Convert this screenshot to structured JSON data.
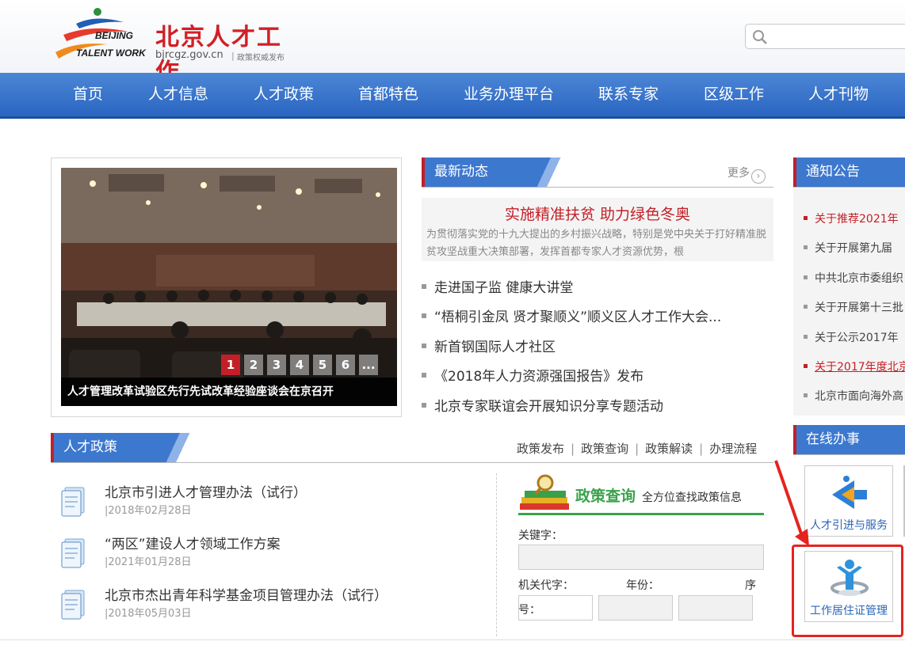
{
  "header": {
    "logo_en_line1": "BEIJING",
    "logo_en_line2": "TALENT WORK",
    "logo_cn": "北京人才工作",
    "logo_url": "bjrcgz.gov.cn",
    "logo_slogan": "政策权威发布",
    "search_value": ""
  },
  "nav": {
    "items": [
      "首页",
      "人才信息",
      "人才政策",
      "首都特色",
      "业务办理平台",
      "联系专家",
      "区级工作",
      "人才刊物"
    ]
  },
  "slider": {
    "caption": "人才管理改革试验区先行先试改革经验座谈会在京召开",
    "pages": [
      "1",
      "2",
      "3",
      "4",
      "5",
      "6",
      "..."
    ],
    "active_page": "1"
  },
  "latest_news": {
    "title": "最新动态",
    "more": "更多",
    "headline": {
      "title": "实施精准扶贫 助力绿色冬奥",
      "summary": "为贯彻落实党的十九大提出的乡村振兴战略，特别是党中央关于打好精准脱贫攻坚战重大决策部署，发挥首都专家人才资源优势，根"
    },
    "items": [
      "走进国子监 健康大讲堂",
      "“梧桐引金凤 贤才聚顺义”顺义区人才工作大会...",
      "新首钢国际人才社区",
      "《2018年人力资源强国报告》发布",
      "北京专家联谊会开展知识分享专题活动"
    ]
  },
  "notices": {
    "title": "通知公告",
    "items": [
      {
        "text": "关于推荐2021年",
        "style": "red"
      },
      {
        "text": "关于开展第九届",
        "style": "normal"
      },
      {
        "text": "中共北京市委组织",
        "style": "normal"
      },
      {
        "text": "关于开展第十三批",
        "style": "normal"
      },
      {
        "text": "关于公示2017年",
        "style": "normal"
      },
      {
        "text": "关于2017年度北京",
        "style": "red-underline"
      },
      {
        "text": "北京市面向海外高",
        "style": "normal"
      }
    ]
  },
  "policy": {
    "title": "人才政策",
    "links": [
      "政策发布",
      "政策查询",
      "政策解读",
      "办理流程"
    ],
    "documents": [
      {
        "title": "北京市引进人才管理办法（试行）",
        "date": "|2018年02月28日"
      },
      {
        "title": "“两区”建设人才领域工作方案",
        "date": "|2021年01月28日"
      },
      {
        "title": "北京市杰出青年科学基金项目管理办法（试行）",
        "date": "|2018年05月03日"
      }
    ]
  },
  "policy_query": {
    "title": "政策查询",
    "subtitle": "全方位查找政策信息",
    "keyword_label": "关键字：",
    "agency_label": "机关代字：",
    "year_label": "年份：",
    "seq_label_1": "序",
    "seq_label_2": "号："
  },
  "online_services": {
    "title": "在线办事",
    "tiles": [
      {
        "label": "人才引进与服务"
      },
      {
        "label": "工作居住证管理"
      }
    ]
  },
  "colors": {
    "nav_blue": "#2a66c2",
    "accent_red": "#c31f27",
    "policy_green": "#39a24a",
    "highlight_red": "#e4241f"
  }
}
